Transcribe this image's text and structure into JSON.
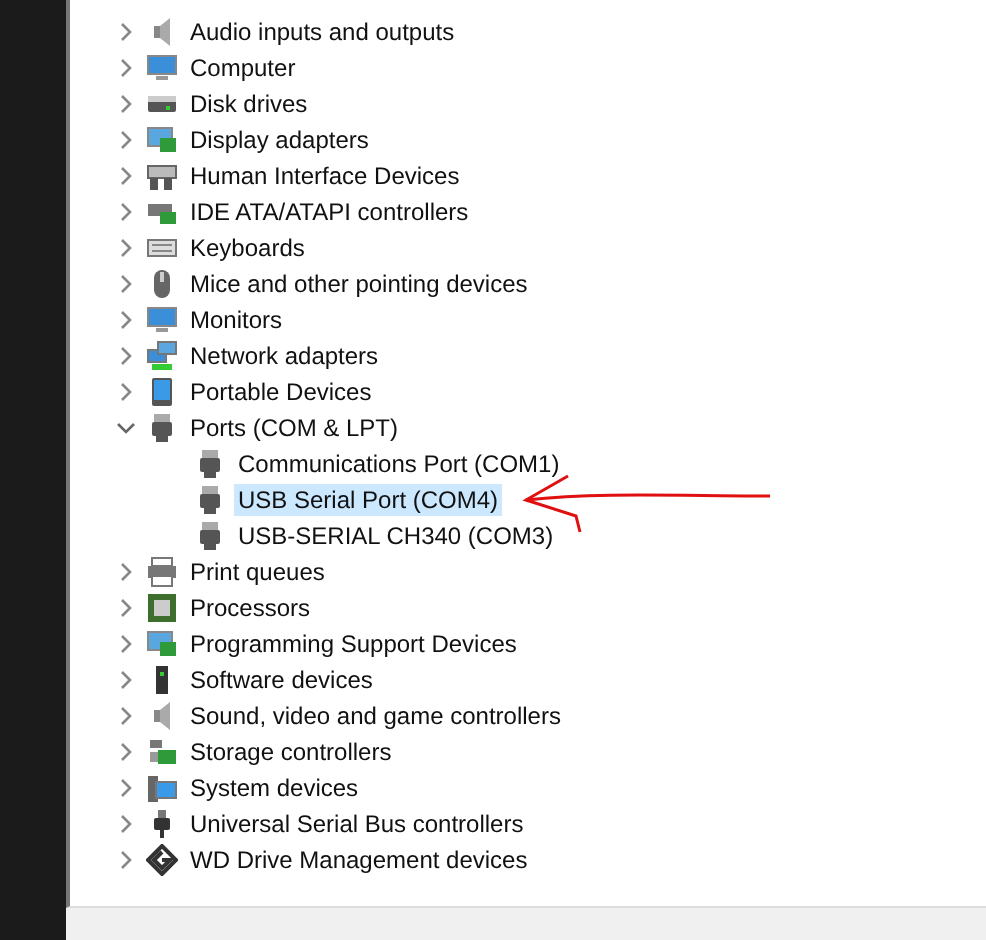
{
  "tree": {
    "items": [
      {
        "label": "Audio inputs and outputs",
        "expanded": false,
        "selected": false
      },
      {
        "label": "Computer",
        "expanded": false,
        "selected": false
      },
      {
        "label": "Disk drives",
        "expanded": false,
        "selected": false
      },
      {
        "label": "Display adapters",
        "expanded": false,
        "selected": false
      },
      {
        "label": "Human Interface Devices",
        "expanded": false,
        "selected": false
      },
      {
        "label": "IDE ATA/ATAPI controllers",
        "expanded": false,
        "selected": false
      },
      {
        "label": "Keyboards",
        "expanded": false,
        "selected": false
      },
      {
        "label": "Mice and other pointing devices",
        "expanded": false,
        "selected": false
      },
      {
        "label": "Monitors",
        "expanded": false,
        "selected": false
      },
      {
        "label": "Network adapters",
        "expanded": false,
        "selected": false
      },
      {
        "label": "Portable Devices",
        "expanded": false,
        "selected": false
      },
      {
        "label": "Ports (COM & LPT)",
        "expanded": true,
        "selected": false,
        "children": [
          {
            "label": "Communications Port (COM1)",
            "selected": false
          },
          {
            "label": "USB Serial Port (COM4)",
            "selected": true
          },
          {
            "label": "USB-SERIAL CH340 (COM3)",
            "selected": false
          }
        ]
      },
      {
        "label": "Print queues",
        "expanded": false,
        "selected": false
      },
      {
        "label": "Processors",
        "expanded": false,
        "selected": false
      },
      {
        "label": "Programming Support Devices",
        "expanded": false,
        "selected": false
      },
      {
        "label": "Software devices",
        "expanded": false,
        "selected": false
      },
      {
        "label": "Sound, video and game controllers",
        "expanded": false,
        "selected": false
      },
      {
        "label": "Storage controllers",
        "expanded": false,
        "selected": false
      },
      {
        "label": "System devices",
        "expanded": false,
        "selected": false
      },
      {
        "label": "Universal Serial Bus controllers",
        "expanded": false,
        "selected": false
      },
      {
        "label": "WD Drive Management devices",
        "expanded": false,
        "selected": false
      }
    ]
  }
}
